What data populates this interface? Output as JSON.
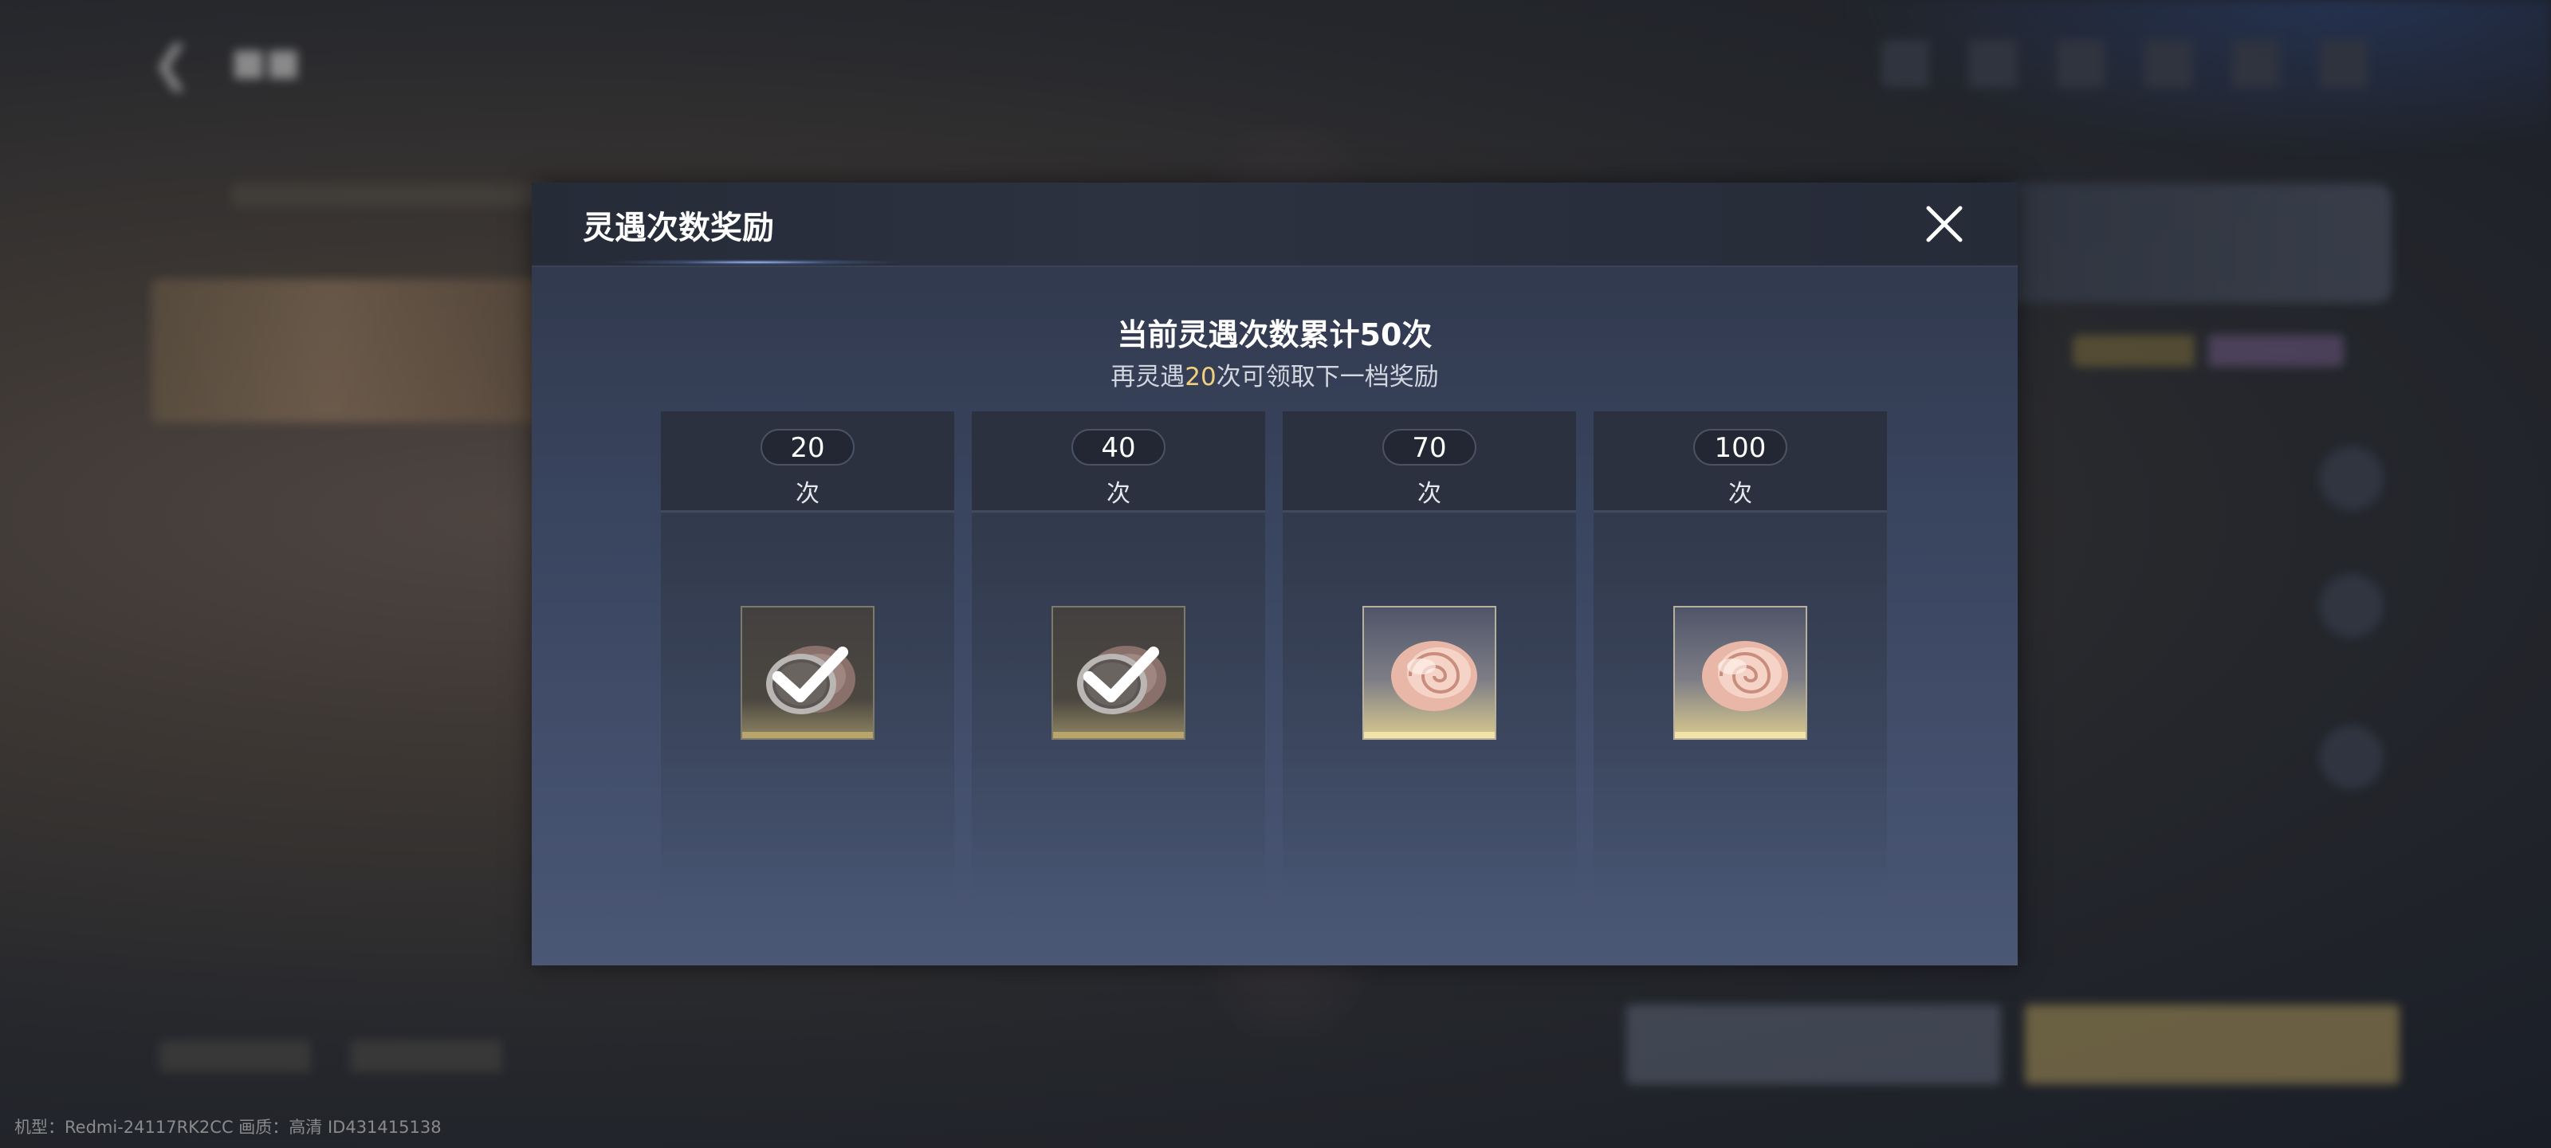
{
  "modal": {
    "title": "灵遇次数奖励",
    "summary": "当前灵遇次数累计50次",
    "hint_prefix": "再灵遇",
    "hint_count": "20",
    "hint_suffix": "次可领取下一档奖励",
    "tiers": [
      {
        "count": "20",
        "unit": "次",
        "status": "claimed"
      },
      {
        "count": "40",
        "unit": "次",
        "status": "claimed"
      },
      {
        "count": "70",
        "unit": "次",
        "status": "unclaimed"
      },
      {
        "count": "100",
        "unit": "次",
        "status": "unclaimed"
      }
    ]
  },
  "footer": {
    "device_info": "机型：Redmi-24117RK2CC 画质：高清 ID431415138"
  },
  "colors": {
    "highlight": "#f1cf7c",
    "modal_top": "#2e3648",
    "modal_bottom": "#4a5775"
  },
  "icons": {
    "reward_item": "shell-icon",
    "claimed_mark": "check-icon",
    "close": "close-icon"
  }
}
